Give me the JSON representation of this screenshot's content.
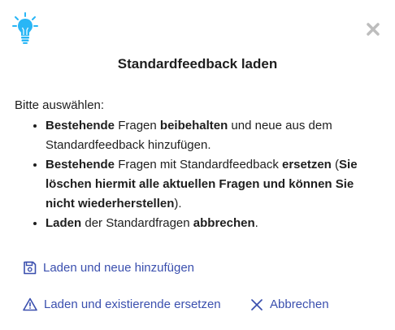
{
  "dialog": {
    "icon": "lightbulb-icon",
    "close_icon": "close-icon",
    "title": "Standardfeedback laden",
    "intro": "Bitte auswählen:",
    "options": [
      {
        "parts": [
          {
            "text": "Bestehende",
            "bold": true
          },
          {
            "text": " Fragen ",
            "bold": false
          },
          {
            "text": "beibehalten",
            "bold": true
          },
          {
            "text": " und neue aus dem Standardfeedback hinzufügen.",
            "bold": false
          }
        ]
      },
      {
        "parts": [
          {
            "text": "Bestehende",
            "bold": true
          },
          {
            "text": " Fragen mit Standardfeedback ",
            "bold": false
          },
          {
            "text": "ersetzen",
            "bold": true
          },
          {
            "text": " (",
            "bold": false
          },
          {
            "text": "Sie löschen hiermit alle aktuellen Fragen und können Sie nicht wiederherstellen",
            "bold": true
          },
          {
            "text": ").",
            "bold": false
          }
        ]
      },
      {
        "parts": [
          {
            "text": "Laden",
            "bold": true
          },
          {
            "text": " der Standardfragen ",
            "bold": false
          },
          {
            "text": "abbrechen",
            "bold": true
          },
          {
            "text": ".",
            "bold": false
          }
        ]
      }
    ],
    "actions": {
      "save_label": "Laden und neue hinzufügen",
      "save_icon": "floppy-disk-icon",
      "replace_label": "Laden und existierende ersetzen",
      "replace_icon": "warning-triangle-icon",
      "cancel_label": "Abbrechen",
      "cancel_icon": "close-x-icon"
    },
    "colors": {
      "accent": "#3a4fae",
      "bulb": "#29b6f6",
      "close": "#bdbdbd",
      "text": "#1e1e1e"
    }
  }
}
